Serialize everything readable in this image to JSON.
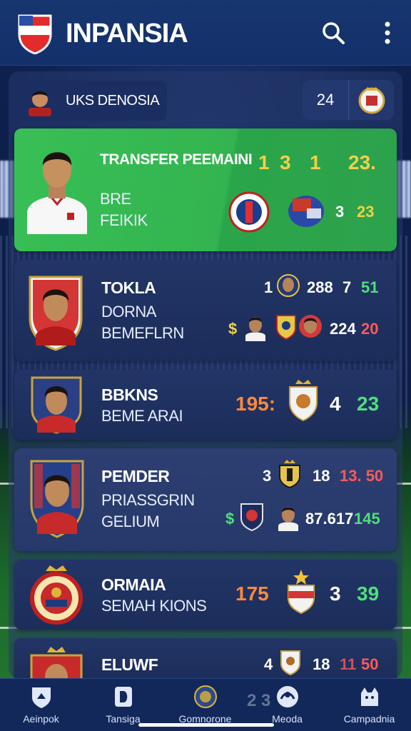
{
  "app": {
    "title": "INPANSIA",
    "accent": "#33b450",
    "topbar_color": "#17356f"
  },
  "user": {
    "name": "UKS DENOSIA",
    "count": "24"
  },
  "cards": [
    {
      "line1": "TRANSFER PEEMAINI",
      "line2": "BRE",
      "line3": "FEIKIK",
      "stats_top": [
        "1",
        "3",
        "1",
        "23."
      ],
      "stats_bottom": [
        "3",
        "23"
      ]
    },
    {
      "line1": "TOKLA",
      "line2": "DORNA",
      "line3": "BEMEFLRN",
      "stats_top": [
        "1",
        "288",
        "7",
        "51"
      ],
      "stats_bottom": [
        "$",
        "224",
        "20"
      ]
    },
    {
      "line1": "BBKNS",
      "line2": "BEME ARAI",
      "stats": [
        "195:",
        "4",
        "23"
      ]
    },
    {
      "line1": "PEMDER",
      "line2": "PRIASSGRIN",
      "line3": "GELIUM",
      "stats_top": [
        "3",
        "18",
        "13. 50"
      ],
      "stats_bottom": [
        "$",
        "87.617",
        "145"
      ]
    },
    {
      "line1": "ORMAIA",
      "line2": "SEMAH KIONS",
      "stats": [
        "175",
        "3",
        "39"
      ]
    },
    {
      "line1": "ELUWF",
      "stats": [
        "4",
        "18",
        "11",
        "50"
      ],
      "faded": "2 3"
    }
  ],
  "nav": [
    {
      "label": "Aeinpok",
      "icon": "shield-home-icon"
    },
    {
      "label": "Tansiga",
      "icon": "d-badge-icon"
    },
    {
      "label": "Gomnorone",
      "icon": "crest-icon"
    },
    {
      "label": "Meoda",
      "icon": "ball-icon"
    },
    {
      "label": "Campadnia",
      "icon": "cat-icon"
    }
  ]
}
